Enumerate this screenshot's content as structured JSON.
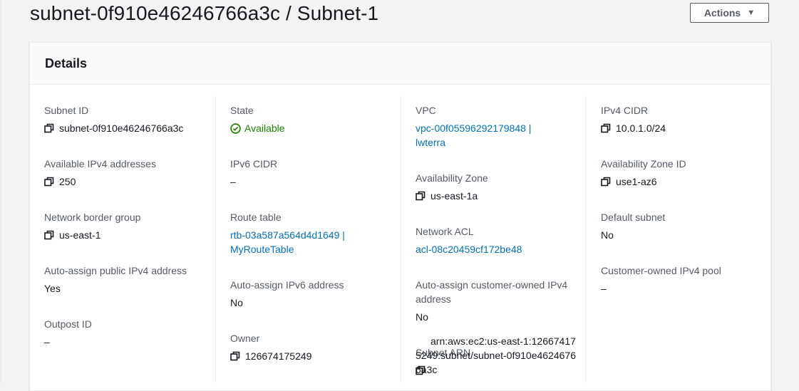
{
  "header": {
    "title": "subnet-0f910e46246766a3c / Subnet-1",
    "actions_label": "Actions"
  },
  "panel": {
    "title": "Details"
  },
  "col1": {
    "subnet_id_label": "Subnet ID",
    "subnet_id_value": "subnet-0f910e46246766a3c",
    "avail_ipv4_label": "Available IPv4 addresses",
    "avail_ipv4_value": "250",
    "border_group_label": "Network border group",
    "border_group_value": "us-east-1",
    "auto_public_label": "Auto-assign public IPv4 address",
    "auto_public_value": "Yes",
    "outpost_label": "Outpost ID",
    "outpost_value": "–"
  },
  "col2": {
    "state_label": "State",
    "state_value": "Available",
    "ipv6_cidr_label": "IPv6 CIDR",
    "ipv6_cidr_value": "–",
    "route_table_label": "Route table",
    "route_table_value": "rtb-03a587a564d4d1649 | MyRouteTable",
    "auto_ipv6_label": "Auto-assign IPv6 address",
    "auto_ipv6_value": "No",
    "owner_label": "Owner",
    "owner_value": "126674175249"
  },
  "col3": {
    "vpc_label": "VPC",
    "vpc_value": "vpc-00f05596292179848 | lwterra",
    "az_label": "Availability Zone",
    "az_value": "us-east-1a",
    "acl_label": "Network ACL",
    "acl_value": "acl-08c20459cf172be48",
    "auto_customer_label": "Auto-assign customer-owned IPv4 address",
    "auto_customer_value": "No",
    "arn_label": "Subnet ARN",
    "arn_value": "arn:aws:ec2:us-east-1:126674175249:subnet/subnet-0f910e46246766a3c"
  },
  "col4": {
    "ipv4_cidr_label": "IPv4 CIDR",
    "ipv4_cidr_value": "10.0.1.0/24",
    "az_id_label": "Availability Zone ID",
    "az_id_value": "use1-az6",
    "default_subnet_label": "Default subnet",
    "default_subnet_value": "No",
    "customer_pool_label": "Customer-owned IPv4 pool",
    "customer_pool_value": "–"
  },
  "colors": {
    "link": "#0073bb",
    "success": "#1d8102",
    "label": "#545b64"
  },
  "icons": {
    "copy": "copy-icon",
    "status": "status-positive-icon",
    "dropdown": "caret-down-icon"
  }
}
